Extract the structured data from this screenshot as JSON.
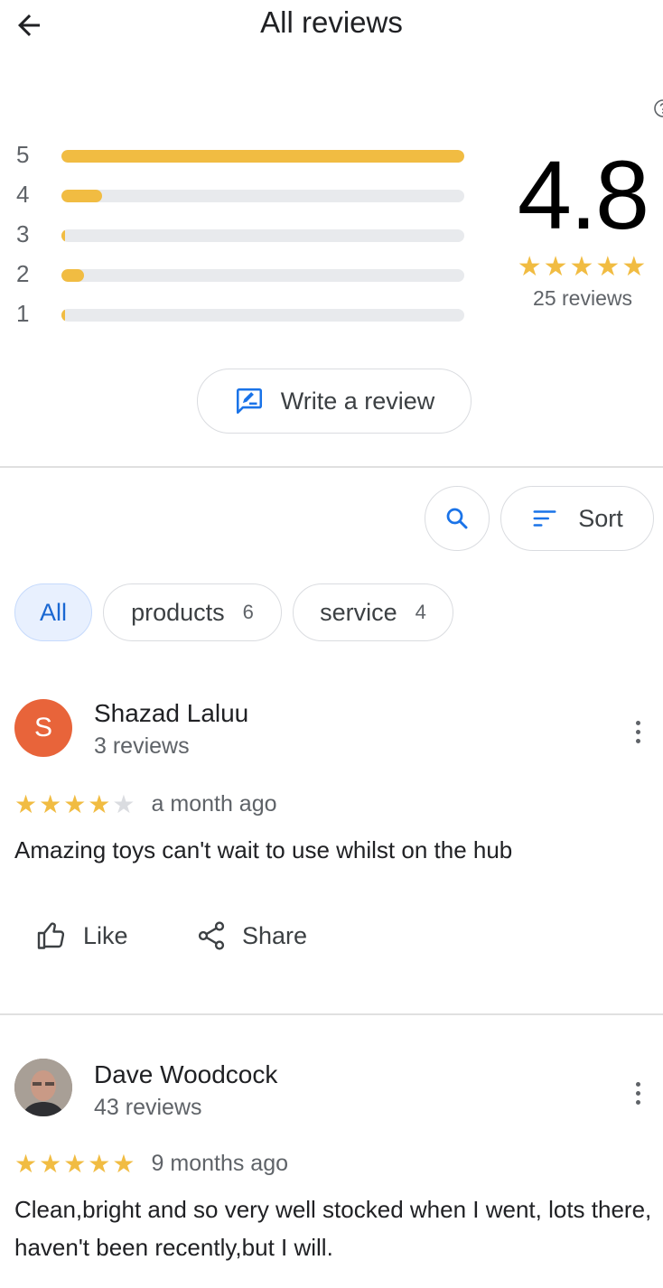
{
  "header": {
    "title": "All reviews",
    "back_icon": "arrow-left-icon"
  },
  "colors": {
    "star": "#f1bc42",
    "track": "#e8eaed",
    "accent_blue": "#1a73e8",
    "avatar_s": "#e8643a"
  },
  "summary": {
    "score": "4.8",
    "stars": "★★★★★",
    "count_text": "25 reviews",
    "distribution": [
      {
        "label": "5",
        "fraction": 1.0
      },
      {
        "label": "4",
        "fraction": 0.1
      },
      {
        "label": "3",
        "fraction": 0.005
      },
      {
        "label": "2",
        "fraction": 0.055
      },
      {
        "label": "1",
        "fraction": 0.005
      }
    ]
  },
  "write_review": {
    "label": "Write a review",
    "icon": "write-review-icon"
  },
  "toolbar": {
    "search_icon": "search-icon",
    "sort_label": "Sort",
    "sort_icon": "sort-icon"
  },
  "filters": [
    {
      "label": "All",
      "count": "",
      "active": true
    },
    {
      "label": "products",
      "count": "6",
      "active": false
    },
    {
      "label": "service",
      "count": "4",
      "active": false
    }
  ],
  "reviews": [
    {
      "initial": "S",
      "name": "Shazad Laluu",
      "sub": "3 reviews",
      "stars_on": "★★★★",
      "stars_off": "★",
      "rating": 4,
      "time": "a month ago",
      "text": "Amazing toys can't wait to use whilst on the hub",
      "like_label": "Like",
      "share_label": "Share"
    },
    {
      "initial": "",
      "name": "Dave Woodcock",
      "sub": "43 reviews",
      "stars_on": "★★★★★",
      "stars_off": "",
      "rating": 5,
      "time": "9 months ago",
      "text": "Clean,bright and so very well stocked when I went, lots there, haven't been recently,but I will."
    }
  ]
}
